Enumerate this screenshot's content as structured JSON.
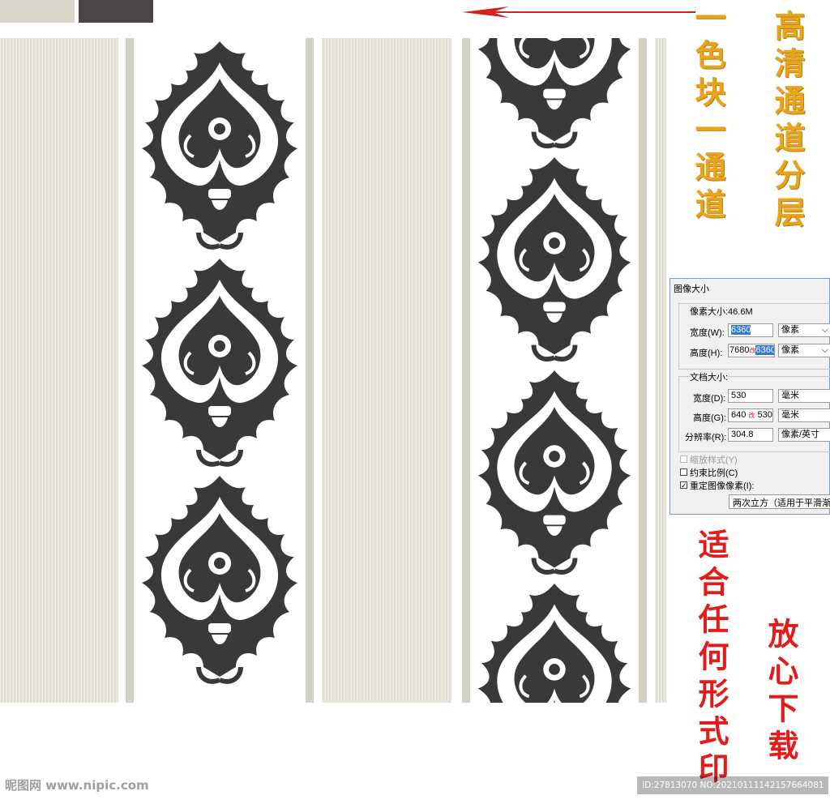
{
  "overlay": {
    "gold_text_1": "高清通道分层",
    "gold_text_2": "一色块一通道",
    "red_text_1": "适合任何形式印",
    "red_text_2": "放心下载"
  },
  "dialog": {
    "title": "图像大小",
    "pixel_size_label": "像素大小:46.6M",
    "width_label": "宽度(W):",
    "width_value": "6360",
    "width_unit": "像素",
    "height_label": "高度(H):",
    "height_value_old": "7680",
    "height_change_mark": "改",
    "height_value_new": "6360",
    "height_unit": "像素",
    "doc_size_label": "文档大小:",
    "doc_width_label": "宽度(D):",
    "doc_width_value": "530",
    "doc_width_unit": "毫米",
    "doc_height_label": "高度(G):",
    "doc_height_value_old": "640",
    "doc_height_change_mark": "改",
    "doc_height_value_new": "530",
    "doc_height_unit": "毫米",
    "resolution_label": "分辨率(R):",
    "resolution_value": "304.8",
    "resolution_unit": "像素/英寸",
    "scale_styles_label": "缩放样式(Y)",
    "constrain_label": "约束比例(C)",
    "resample_label": "重定图像像素(I):",
    "resample_method": "两次立方（适用于平滑渐变"
  },
  "watermark": {
    "site_logo": "昵图网 www.nipic.com",
    "id_text": "ID:27813070 NO:20210111142157664081"
  },
  "colors": {
    "stripe": "#e6e3d8",
    "pillar": "#d3d1c6",
    "damask": "#3b3938",
    "gold": "#e8a51c",
    "red": "#e21b1b",
    "arrow": "#d81e1e",
    "swatch_light": "#d9d6cb",
    "swatch_dark": "#4a4649"
  }
}
